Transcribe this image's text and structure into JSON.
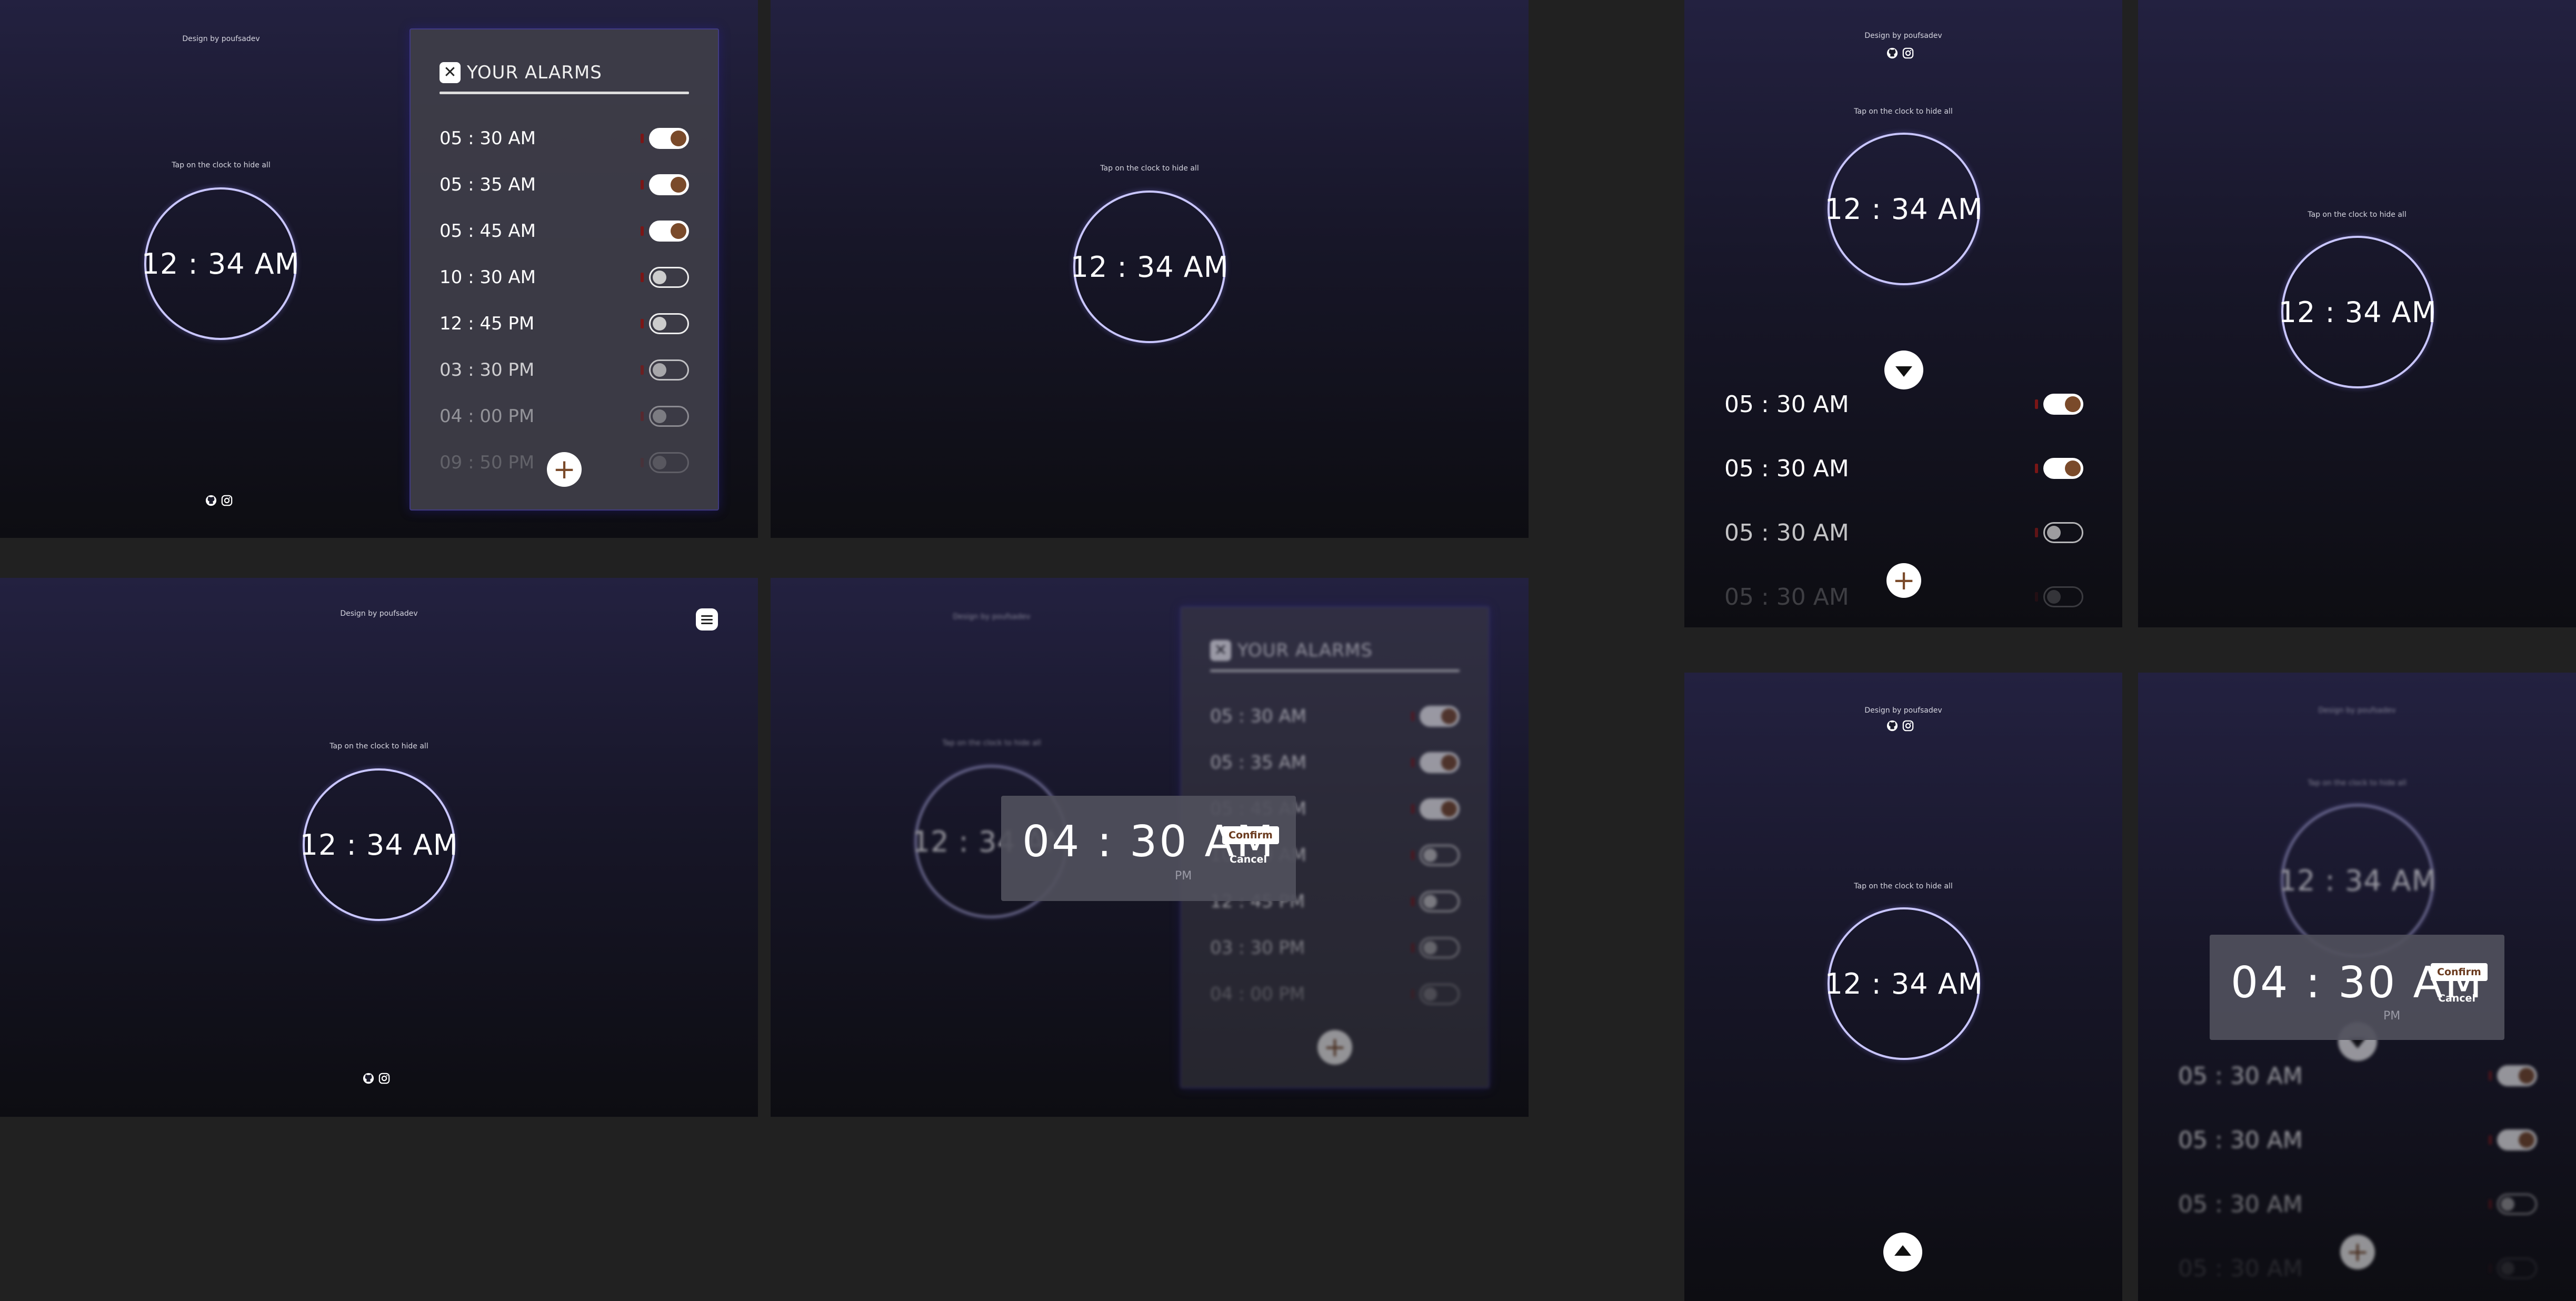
{
  "app": {
    "credit": "Design by poufsadev",
    "hint": "Tap on the clock to hide all",
    "clock": "12 : 34 AM"
  },
  "alarms_card": {
    "title": "YOUR ALARMS",
    "close_icon": "close-icon",
    "items": [
      {
        "time": "05 : 30 AM",
        "enabled": true
      },
      {
        "time": "05 : 35 AM",
        "enabled": true
      },
      {
        "time": "05 : 45 AM",
        "enabled": true
      },
      {
        "time": "10 : 30 AM",
        "enabled": false
      },
      {
        "time": "12 : 45 PM",
        "enabled": false
      },
      {
        "time": "03 : 30 PM",
        "enabled": false
      },
      {
        "time": "04 : 00 PM",
        "enabled": false
      },
      {
        "time": "09 : 50 PM",
        "enabled": false
      }
    ],
    "add_icon": "plus-icon"
  },
  "mobile_alarms": {
    "items": [
      {
        "time": "05 : 30 AM",
        "enabled": true
      },
      {
        "time": "05 : 30 AM",
        "enabled": true
      },
      {
        "time": "05 : 30 AM",
        "enabled": false
      },
      {
        "time": "05 : 30 AM",
        "enabled": false
      }
    ]
  },
  "time_picker": {
    "hours": "04",
    "minutes": "30",
    "period": "AM",
    "alt_period": "PM",
    "confirm_label": "Confirm",
    "cancel_label": "Cancel"
  },
  "icons": [
    "github-icon",
    "instagram-icon",
    "menu-icon",
    "chevron-down-icon",
    "chevron-up-icon",
    "plus-icon",
    "close-icon"
  ],
  "colors": {
    "background": "#212121",
    "panel_top": "#232140",
    "panel_bottom": "#0d0d12",
    "clock_ring": "#c9c6ff",
    "toggle_knob": "#7a4a2a",
    "accent_red": "#7a1616"
  }
}
